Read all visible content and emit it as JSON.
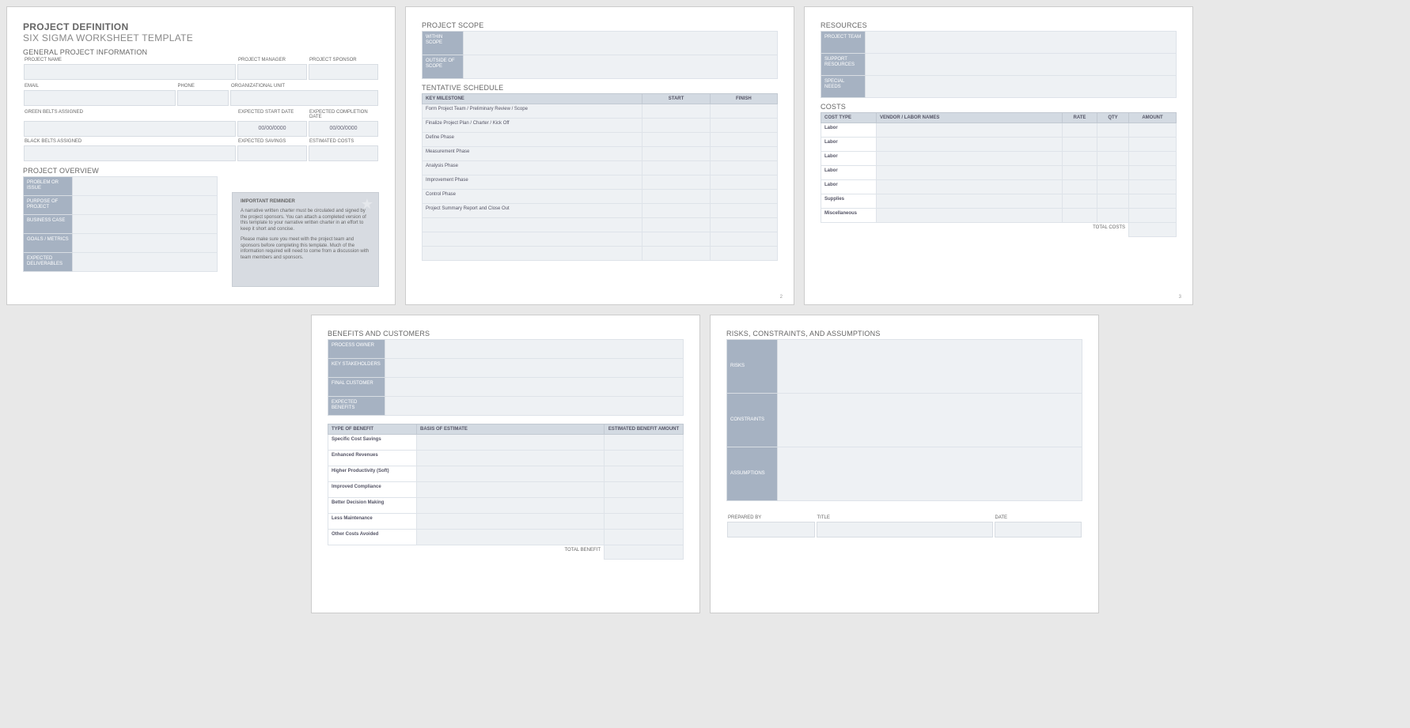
{
  "page1": {
    "title": "PROJECT DEFINITION",
    "subtitle": "SIX SIGMA WORKSHEET TEMPLATE",
    "sec_general": "GENERAL PROJECT INFORMATION",
    "lbl_projectname": "PROJECT NAME",
    "lbl_pm": "PROJECT MANAGER",
    "lbl_sponsor": "PROJECT SPONSOR",
    "lbl_email": "EMAIL",
    "lbl_phone": "PHONE",
    "lbl_org": "ORGANIZATIONAL UNIT",
    "lbl_green": "GREEN BELTS ASSIGNED",
    "lbl_start": "EXPECTED START DATE",
    "lbl_comp": "EXPECTED COMPLETION DATE",
    "date_placeholder": "00/00/0000",
    "lbl_black": "BLACK BELTS ASSIGNED",
    "lbl_savings": "EXPECTED SAVINGS",
    "lbl_costs": "ESTIMATED COSTS",
    "sec_overview": "PROJECT OVERVIEW",
    "ov": {
      "problem": "PROBLEM OR ISSUE",
      "purpose": "PURPOSE OF PROJECT",
      "business": "BUSINESS CASE",
      "goals": "GOALS / METRICS",
      "deliv": "EXPECTED DELIVERABLES"
    },
    "note": {
      "title": "IMPORTANT REMINDER",
      "p1": "A narrative written charter must be circulated and signed by the project sponsors. You can attach a completed version of this template to your narrative written charter in an effort to keep it short and concise.",
      "p2": "Please make sure you meet with the project team and sponsors before completing this template. Much of the information required will need to come from a discussion with team members and sponsors."
    }
  },
  "page2": {
    "sec_scope": "PROJECT SCOPE",
    "within": "WITHIN SCOPE",
    "outside": "OUTSIDE OF SCOPE",
    "sec_sched": "TENTATIVE SCHEDULE",
    "cols": {
      "milestone": "KEY MILESTONE",
      "start": "START",
      "finish": "FINISH"
    },
    "rows": [
      "Form Project Team / Preliminary Review / Scope",
      "Finalize Project Plan / Charter / Kick Off",
      "Define Phase",
      "Measurement Phase",
      "Analysis Phase",
      "Improvement Phase",
      "Control Phase",
      "Project Summary Report and Close Out",
      "",
      "",
      ""
    ],
    "pagenum": "2"
  },
  "page3": {
    "sec_res": "RESOURCES",
    "res": {
      "team": "PROJECT TEAM",
      "support": "SUPPORT RESOURCES",
      "special": "SPECIAL NEEDS"
    },
    "sec_costs": "COSTS",
    "cols": {
      "type": "COST TYPE",
      "vendor": "VENDOR / LABOR NAMES",
      "rate": "RATE",
      "qty": "QTY",
      "amount": "AMOUNT"
    },
    "rows": [
      "Labor",
      "Labor",
      "Labor",
      "Labor",
      "Labor",
      "Supplies",
      "Miscellaneous"
    ],
    "total": "TOTAL COSTS",
    "pagenum": "3"
  },
  "page4": {
    "sec_ben": "BENEFITS AND CUSTOMERS",
    "side": {
      "owner": "PROCESS OWNER",
      "stake": "KEY STAKEHOLDERS",
      "cust": "FINAL CUSTOMER",
      "exp": "EXPECTED BENEFITS"
    },
    "cols": {
      "type": "TYPE OF BENEFIT",
      "basis": "BASIS OF ESTIMATE",
      "amount": "ESTIMATED BENEFIT AMOUNT"
    },
    "rows": [
      "Specific Cost Savings",
      "Enhanced Revenues",
      "Higher Productivity (Soft)",
      "Improved Compliance",
      "Better Decision Making",
      "Less Maintenance",
      "Other Costs Avoided"
    ],
    "total": "TOTAL BENEFIT"
  },
  "page5": {
    "sec_rca": "RISKS, CONSTRAINTS, AND ASSUMPTIONS",
    "risks": "RISKS",
    "constraints": "CONSTRAINTS",
    "assumptions": "ASSUMPTIONS",
    "lbl_prepared": "PREPARED BY",
    "lbl_title": "TITLE",
    "lbl_date": "DATE"
  }
}
